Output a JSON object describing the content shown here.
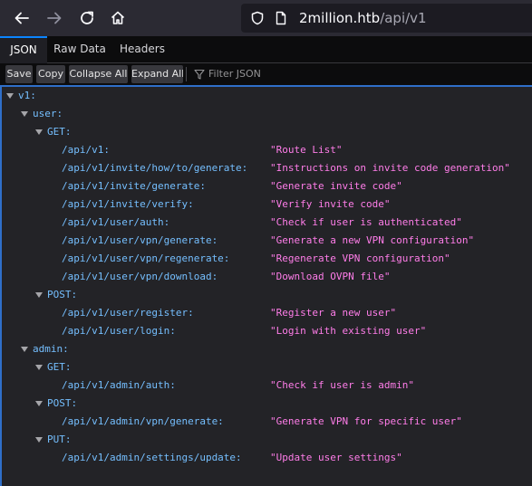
{
  "browser": {
    "url_host": "2million.htb",
    "url_path": "/api/v1",
    "icons": [
      "back-icon",
      "forward-icon",
      "reload-icon",
      "home-icon",
      "shield-icon",
      "page-icon"
    ]
  },
  "viewer": {
    "tabs": [
      {
        "label": "JSON",
        "active": true
      },
      {
        "label": "Raw Data",
        "active": false
      },
      {
        "label": "Headers",
        "active": false
      }
    ],
    "toolbar": {
      "save_label": "Save",
      "copy_label": "Copy",
      "collapse_label": "Collapse All",
      "expand_label": "Expand All",
      "filter_placeholder": "Filter JSON"
    }
  },
  "tree": {
    "root": "v1:",
    "user": "user:",
    "user_get": "GET:",
    "user_get_items": [
      {
        "key": "/api/v1:",
        "value": "\"Route List\""
      },
      {
        "key": "/api/v1/invite/how/to/generate:",
        "value": "\"Instructions on invite code generation\""
      },
      {
        "key": "/api/v1/invite/generate:",
        "value": "\"Generate invite code\""
      },
      {
        "key": "/api/v1/invite/verify:",
        "value": "\"Verify invite code\""
      },
      {
        "key": "/api/v1/user/auth:",
        "value": "\"Check if user is authenticated\""
      },
      {
        "key": "/api/v1/user/vpn/generate:",
        "value": "\"Generate a new VPN configuration\""
      },
      {
        "key": "/api/v1/user/vpn/regenerate:",
        "value": "\"Regenerate VPN configuration\""
      },
      {
        "key": "/api/v1/user/vpn/download:",
        "value": "\"Download OVPN file\""
      }
    ],
    "user_post": "POST:",
    "user_post_items": [
      {
        "key": "/api/v1/user/register:",
        "value": "\"Register a new user\""
      },
      {
        "key": "/api/v1/user/login:",
        "value": "\"Login with existing user\""
      }
    ],
    "admin": "admin:",
    "admin_get": "GET:",
    "admin_get_items": [
      {
        "key": "/api/v1/admin/auth:",
        "value": "\"Check if user is admin\""
      }
    ],
    "admin_post": "POST:",
    "admin_post_items": [
      {
        "key": "/api/v1/admin/vpn/generate:",
        "value": "\"Generate VPN for specific user\""
      }
    ],
    "admin_put": "PUT:",
    "admin_put_items": [
      {
        "key": "/api/v1/admin/settings/update:",
        "value": "\"Update user settings\""
      }
    ]
  }
}
